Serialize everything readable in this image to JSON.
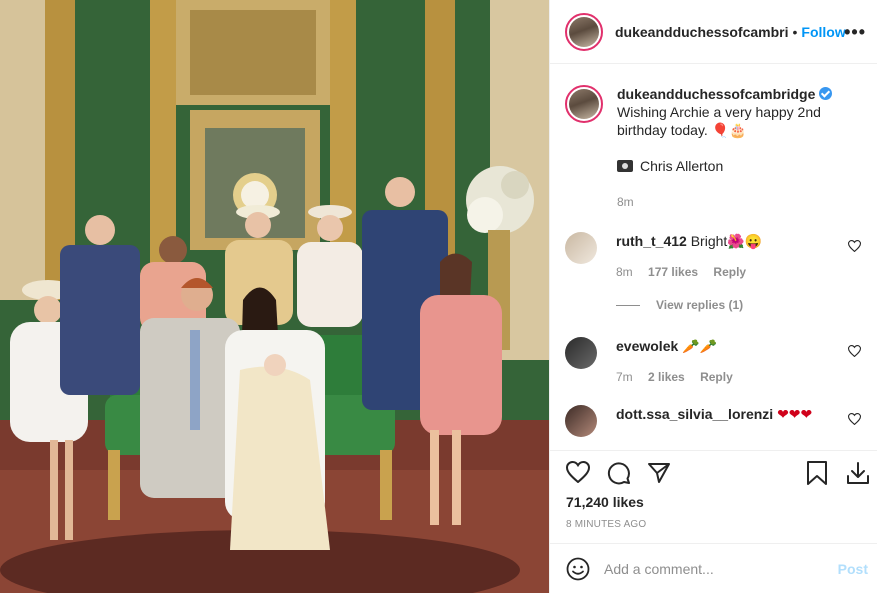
{
  "photo": {
    "alt": ""
  },
  "header": {
    "username": "dukeandduchessofcambri",
    "separator": "•",
    "follow_label": "Follow",
    "more_label": "•••"
  },
  "caption": {
    "username": "dukeandduchessofcambridge",
    "text": "Wishing Archie a very happy 2nd birthday today. 🎈🎂",
    "credit": "Chris Allerton",
    "time": "8m"
  },
  "comments": [
    {
      "username": "ruth_t_412",
      "text": "Bright🌺😛",
      "time": "8m",
      "likes": "177 likes",
      "reply_label": "Reply",
      "view_replies": "View replies (1)"
    },
    {
      "username": "evewolek",
      "text": "🥕🥕",
      "time": "7m",
      "likes": "2 likes",
      "reply_label": "Reply"
    },
    {
      "username": "dott.ssa_silvia__lorenzi",
      "text": "❤❤❤"
    }
  ],
  "actions": {
    "likes": "71,240 likes",
    "timestamp": "8 MINUTES AGO"
  },
  "add_comment": {
    "placeholder": "Add a comment...",
    "post_label": "Post"
  },
  "colors": {
    "follow": "#0095f6",
    "verified": "#3897f0",
    "post_disabled": "#b2dffc",
    "muted": "#8e8e8e"
  },
  "icons": [
    "heart-icon",
    "comment-icon",
    "share-icon",
    "bookmark-icon",
    "download-icon",
    "emoji-icon",
    "camera-icon",
    "verified-badge-icon",
    "more-options-icon"
  ]
}
